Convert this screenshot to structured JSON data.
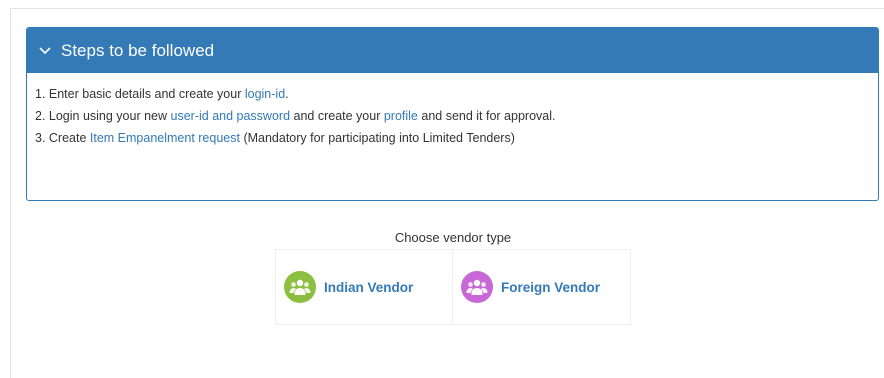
{
  "panel": {
    "title": "Steps to be followed",
    "steps": [
      {
        "prefix": "1. Enter basic details and create your ",
        "link1": "login-id",
        "suffix": "."
      },
      {
        "prefix": "2. Login using your new ",
        "link1": "user-id and password",
        "middle": " and create your ",
        "link2": "profile",
        "suffix": " and send it for approval."
      },
      {
        "prefix": "3. Create ",
        "link1": "Item Empanelment request",
        "suffix": " (Mandatory for participating into Limited Tenders)"
      }
    ]
  },
  "vendor": {
    "label": "Choose vendor type",
    "options": [
      {
        "name": "Indian Vendor",
        "color": "#8cbf3f"
      },
      {
        "name": "Foreign Vendor",
        "color": "#c867d8"
      }
    ]
  },
  "colors": {
    "accent": "#337ab7"
  },
  "icons": {
    "chevron": "chevron-down-icon",
    "vendor": "users-icon"
  }
}
